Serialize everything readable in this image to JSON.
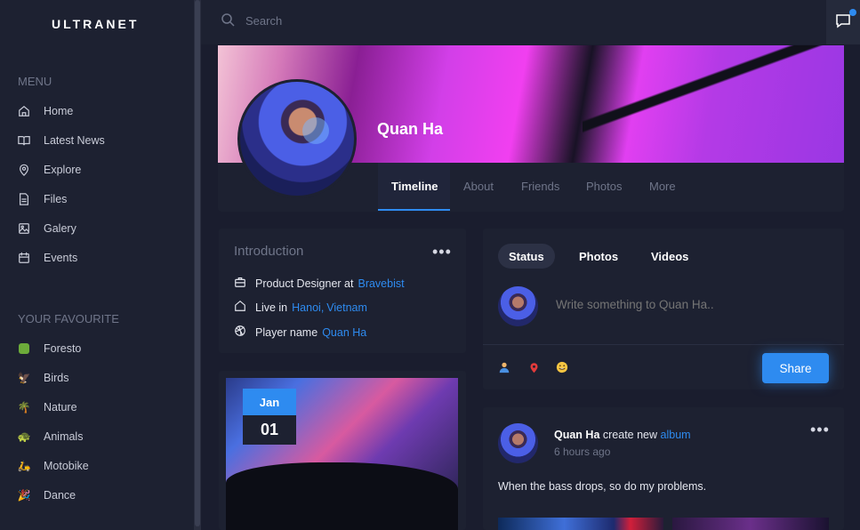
{
  "app": {
    "logo": "ULTRANET"
  },
  "sidebar": {
    "menu_title": "MENU",
    "menu": [
      {
        "label": "Home",
        "icon": "home-icon"
      },
      {
        "label": "Latest News",
        "icon": "book-icon"
      },
      {
        "label": "Explore",
        "icon": "location-pin-icon"
      },
      {
        "label": "Files",
        "icon": "file-icon"
      },
      {
        "label": "Galery",
        "icon": "image-icon"
      },
      {
        "label": "Events",
        "icon": "calendar-icon"
      }
    ],
    "fav_title": "YOUR FAVOURITE",
    "favourites": [
      {
        "label": "Foresto",
        "icon": "forest-icon"
      },
      {
        "label": "Birds",
        "icon": "bird-icon"
      },
      {
        "label": "Nature",
        "icon": "palm-tree-icon"
      },
      {
        "label": "Animals",
        "icon": "animal-icon"
      },
      {
        "label": "Motobike",
        "icon": "motorbike-icon"
      },
      {
        "label": "Dance",
        "icon": "party-popper-icon"
      }
    ]
  },
  "topbar": {
    "search_placeholder": "Search",
    "notification_color": "#2e8bf0"
  },
  "profile": {
    "name": "Quan Ha",
    "tabs": [
      "Timeline",
      "About",
      "Friends",
      "Photos",
      "More"
    ],
    "active_tab": "Timeline"
  },
  "intro": {
    "title": "Introduction",
    "more": "•••",
    "rows": [
      {
        "icon": "briefcase-icon",
        "text": "Product Designer at",
        "links": [
          "Bravebist"
        ]
      },
      {
        "icon": "home-icon",
        "text": "Live in",
        "links": [
          "Hanoi",
          "Vietnam"
        ],
        "separator": ","
      },
      {
        "icon": "dribbble-icon",
        "text": "Player name",
        "links": [
          "Quan Ha"
        ]
      }
    ]
  },
  "event": {
    "month": "Jan",
    "day": "01"
  },
  "composer": {
    "tabs": [
      "Status",
      "Photos",
      "Videos"
    ],
    "active_tab": "Status",
    "placeholder": "Write something to Quan Ha..",
    "tools": [
      "user-icon",
      "location-pin-icon",
      "emoji-icon"
    ],
    "share_label": "Share"
  },
  "post": {
    "author": "Quan Ha",
    "action": "create new",
    "link": "album",
    "time": "6 hours ago",
    "text": "When the bass drops, so do my problems.",
    "more": "•••"
  },
  "colors": {
    "accent": "#2e8bf0",
    "bg": "#1a1d2e",
    "card": "#1d2131"
  }
}
